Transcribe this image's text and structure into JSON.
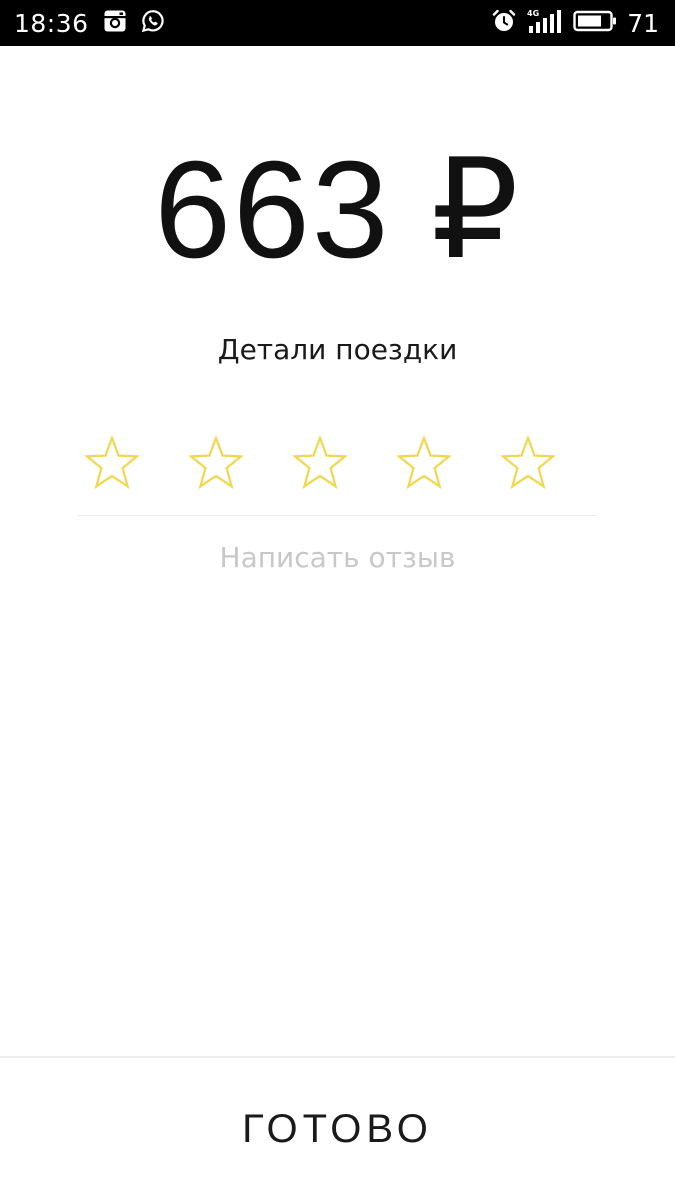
{
  "status_bar": {
    "time": "18:36",
    "network": "4G",
    "battery_level": "71",
    "icons": [
      "instagram-icon",
      "whatsapp-icon",
      "alarm-icon",
      "signal-icon",
      "battery-icon"
    ]
  },
  "trip": {
    "price": "663 ₽",
    "details_label": "Детали поездки"
  },
  "rating": {
    "max_stars": 5,
    "selected": 0,
    "star_color": "#f2d64b"
  },
  "review": {
    "placeholder": "Написать отзыв"
  },
  "footer": {
    "done_label": "ГОТОВО"
  }
}
